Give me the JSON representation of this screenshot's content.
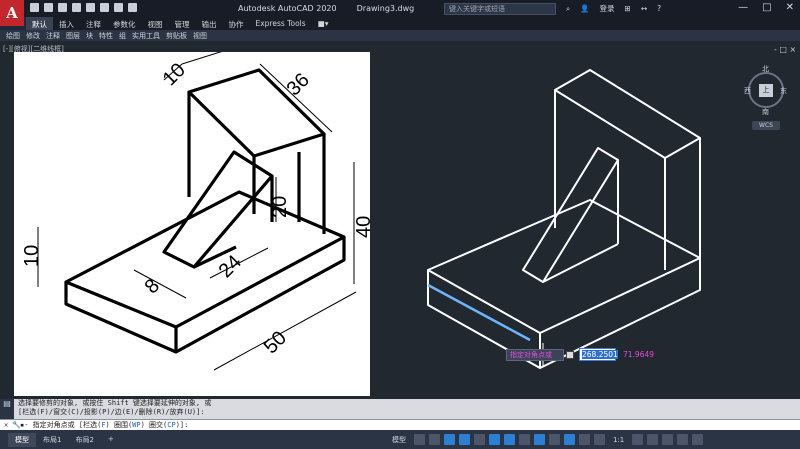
{
  "app": {
    "logo_letter": "A",
    "product": "Autodesk AutoCAD 2020",
    "document": "Drawing3.dwg",
    "search_placeholder": "键入关键字或短语",
    "sign_in": "登录",
    "window_controls": [
      "—",
      "□",
      "✕"
    ]
  },
  "ribbon": {
    "tabs": [
      "默认",
      "插入",
      "注释",
      "参数化",
      "视图",
      "管理",
      "输出",
      "协作",
      "Express Tools",
      "■▾"
    ],
    "active_tab": "默认",
    "panels": [
      "绘图",
      "修改",
      "注释",
      "图层",
      "块",
      "特性",
      "组",
      "实用工具",
      "剪贴板",
      "视图"
    ]
  },
  "viewport": {
    "label": "[-][俯视][二维线框]",
    "close": "- □ ×"
  },
  "viewcube": {
    "north": "北",
    "west": "西",
    "east": "东",
    "south": "南",
    "face": "上",
    "wcs": "WCS"
  },
  "reference_dimensions": [
    "10",
    "36",
    "20",
    "40",
    "10",
    "8",
    "24",
    "50"
  ],
  "dynamic_input": {
    "prompt": "指定对角点或",
    "x_value": "268.2501",
    "y_value": "71.9649"
  },
  "command": {
    "history_1": "选择要修剪的对象, 或按住 Shift 键选择要延伸的对象, 或",
    "history_2": "[栏选(F)/窗交(C)/投影(P)/边(E)/删除(R)/放弃(U)]:",
    "prompt_prefix": "▪- 指定对角点或 [栏选(",
    "prompt_kw1": "F",
    "prompt_mid1": ") 圈围(",
    "prompt_kw2": "WP",
    "prompt_mid2": ") 圈交(",
    "prompt_kw3": "CP",
    "prompt_suffix": ")]:"
  },
  "status": {
    "layout_tabs": [
      "模型",
      "布局1",
      "布局2",
      "+"
    ],
    "active_layout": "模型",
    "model_label": "模型",
    "scale": "1:1"
  },
  "colors": {
    "background": "#212830",
    "accent": "#2c7fd2",
    "dynamic_text": "#e34be3"
  }
}
